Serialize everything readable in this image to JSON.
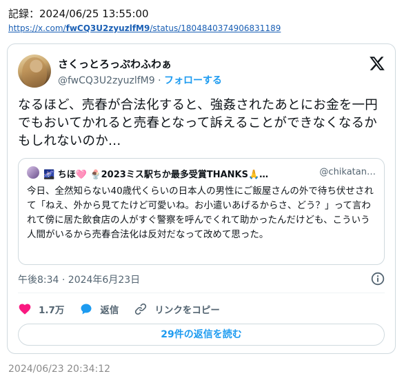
{
  "record": {
    "label": "記録：2024/06/25 13:55:00"
  },
  "url": {
    "prefix": "https://x.com/",
    "user": "fwCQ3U2zyuzlfM9",
    "suffix": "/status/1804840374906831189"
  },
  "tweet": {
    "display_name": "さくっとろっぷわふわぁ",
    "handle": "@fwCQ3U2zyuzlfM9",
    "separator": " · ",
    "follow_label": "フォローする",
    "text": "なるほど、売春が合法化すると、強姦されたあとにお金を一円でもおいてかれると売春となって訴えることができなくなるかもしれないのか…",
    "timestamp": "午後8:34 · 2024年6月23日"
  },
  "quote": {
    "emoji_1": "🌌",
    "name": "ちほ",
    "emoji_2": "🩷",
    "emoji_3": "🍨",
    "title": "2023ミス駅ちか最多受賞THANKS🙏…",
    "handle": "@chikatan…",
    "text": "今日、全然知らない40歳代くらいの日本人の男性にご飯屋さんの外で待ち伏せされて「ねえ、外から見てたけど可愛いね。お小遣いあげるからさ、どう？」って言われて傍に居た飲食店の人がすぐ警察を呼んでくれて助かったんだけども、こういう人間がいるから売春合法化は反対だなって改めて思った。"
  },
  "actions": {
    "like_count": "1.7万",
    "reply_label": "返信",
    "copy_link_label": "リンクをコピー"
  },
  "replies_button": {
    "label": "29件の返信を読む"
  },
  "footer": {
    "date": "2024/06/23 20:34:12"
  },
  "colors": {
    "accent": "#1d9bf0",
    "like": "#f91880",
    "muted": "#536471",
    "border": "#cfd9de"
  },
  "icons": [
    "x-logo-icon",
    "info-icon",
    "heart-icon",
    "reply-bubble-icon",
    "link-icon"
  ]
}
